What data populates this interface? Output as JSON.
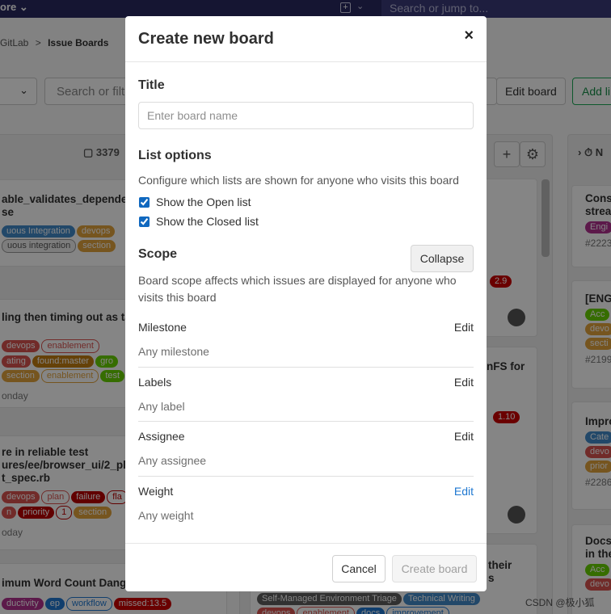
{
  "topnav": {
    "brand": "ore ⌄",
    "plus_glyph": "+",
    "plus_chevron": "⌄",
    "search_placeholder": "Search or jump to..."
  },
  "breadcrumb": {
    "parent": "GitLab",
    "separator": ">",
    "current": "Issue Boards"
  },
  "filterbar": {
    "select_chevron": "⌄",
    "search_placeholder": "Search or filte",
    "edit_board": "Edit board",
    "add_list": "Add li"
  },
  "boards": {
    "b1": {
      "count": "3379",
      "cards": [
        {
          "title1": "able_validates_depender",
          "title2": "se",
          "chips": [
            {
              "text": "uous Integration",
              "bg": "#428bca"
            },
            {
              "text": "devops",
              "bg": "#e3a33d"
            }
          ],
          "chips2": [
            {
              "text": "uous integration",
              "bg": "#f5f5f5",
              "fg": "#555"
            },
            {
              "text": "section",
              "bg": "#e3a33d"
            }
          ]
        },
        {
          "title1": "ling then timing out as ta",
          "chips": [
            {
              "text": "devops",
              "bg": "#d9534f"
            },
            {
              "text": "enablement",
              "bg": "#fff",
              "fg": "#d9534f"
            }
          ],
          "chips2": [
            {
              "text": "ating",
              "bg": "#d9534f"
            },
            {
              "text": "found:master",
              "bg": "#c17d11"
            },
            {
              "text": "gro",
              "bg": "#69d100"
            }
          ],
          "chips3": [
            {
              "text": "section",
              "bg": "#e3a33d"
            },
            {
              "text": "enablement",
              "bg": "#fff",
              "fg": "#e3a33d"
            },
            {
              "text": "test",
              "bg": "#69d100"
            }
          ],
          "sub": "onday"
        },
        {
          "title1": "re in reliable test",
          "title2": "ures/ee/browser_ui/2_pla",
          "title3": "t_spec.rb",
          "chips": [
            {
              "text": "devops",
              "bg": "#d9534f"
            },
            {
              "text": "plan",
              "bg": "#fff",
              "fg": "#d9534f"
            },
            {
              "text": "failure",
              "bg": "#b00"
            },
            {
              "text": "fla",
              "bg": "#fff",
              "fg": "#b00"
            }
          ],
          "chips2": [
            {
              "text": "n",
              "bg": "#d9534f"
            },
            {
              "text": "priority",
              "bg": "#b00"
            },
            {
              "text": "1",
              "bg": "#fff",
              "fg": "#b00"
            },
            {
              "text": "section",
              "bg": "#e3a33d"
            }
          ],
          "sub": "oday"
        },
        {
          "title1": "imum Word Count Dange",
          "chips": [
            {
              "text": "ductivity",
              "bg": "#b0308f"
            },
            {
              "text": "ep",
              "bg": "#1f78d1"
            },
            {
              "text": "workflow",
              "bg": "#fff",
              "fg": "#1f78d1"
            },
            {
              "text": "missed:13.5",
              "bg": "#c00"
            }
          ]
        }
      ]
    },
    "b2": {
      "plus_glyph": "+",
      "gear_glyph": "⚙",
      "fragments": {
        "badge_a": "2.9",
        "text_b": "nFS for",
        "badge_c": "1.10",
        "text_d": "their",
        "text_e": "s"
      },
      "bottom_chips": [
        {
          "text": "Self-Managed Environment Triage",
          "bg": "#5e5e5e"
        },
        {
          "text": "Technical Writing",
          "bg": "#428bca"
        }
      ],
      "bottom_chips2": [
        {
          "text": "devops",
          "bg": "#d9534f"
        },
        {
          "text": "enablement",
          "bg": "#fff",
          "fg": "#d9534f"
        },
        {
          "text": "docs",
          "bg": "#1f78d1"
        },
        {
          "text": "improvement",
          "bg": "#fff",
          "fg": "#1f78d1"
        }
      ]
    },
    "b3": {
      "header": "› ⏱ N",
      "cards": [
        {
          "t1": "Cons",
          "t2": "strea",
          "chip": "Engi",
          "chip_bg": "#b0308f",
          "num": "#2223"
        },
        {
          "t1": "[ENG",
          "chip": "Acc",
          "chip_bg": "#69d100",
          "chip2": "devo",
          "chip3": "secti",
          "num": "#2199"
        },
        {
          "t1": "Impro",
          "chip": "Cate",
          "chip_bg": "#428bca",
          "chip2": "devo",
          "chip3": "prior",
          "num": "#2286"
        },
        {
          "t1": "Docs",
          "t2": "in the",
          "chip": "Acc",
          "chip_bg": "#69d100",
          "chip2": "devo"
        }
      ]
    }
  },
  "modal": {
    "title": "Create new board",
    "close_glyph": "×",
    "title_section": {
      "heading": "Title",
      "placeholder": "Enter board name",
      "value": ""
    },
    "list_options": {
      "heading": "List options",
      "description": "Configure which lists are shown for anyone who visits this board",
      "open_label": "Show the Open list",
      "closed_label": "Show the Closed list"
    },
    "scope": {
      "heading": "Scope",
      "collapse": "Collapse",
      "description": "Board scope affects which issues are displayed for anyone who visits this board",
      "items": [
        {
          "label": "Milestone",
          "edit": "Edit",
          "value": "Any milestone"
        },
        {
          "label": "Labels",
          "edit": "Edit",
          "value": "Any label"
        },
        {
          "label": "Assignee",
          "edit": "Edit",
          "value": "Any assignee"
        },
        {
          "label": "Weight",
          "edit": "Edit",
          "value": "Any weight"
        }
      ]
    },
    "footer": {
      "cancel": "Cancel",
      "create": "Create board"
    }
  },
  "watermark": "CSDN @极小狐",
  "colors": {
    "primary_link": "#1f78d1",
    "checkbox": "#1068bf",
    "nav_bg": "#292961"
  },
  "icons": [
    "close-icon",
    "gear-icon",
    "plus-icon",
    "chevron-down-icon",
    "timer-icon"
  ]
}
